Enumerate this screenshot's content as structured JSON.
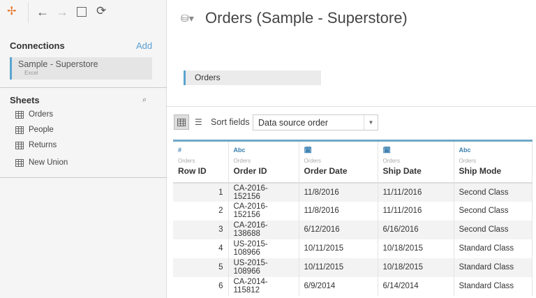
{
  "toolbar": {
    "logo": "tableau-logo",
    "back": "←",
    "forward": "→",
    "save": "save-icon",
    "refresh": "refresh-icon"
  },
  "sidebar": {
    "connections_label": "Connections",
    "add_label": "Add",
    "connection": {
      "name": "Sample - Superstore",
      "type": "Excel"
    },
    "sheets_label": "Sheets",
    "sheets": [
      {
        "label": "Orders"
      },
      {
        "label": "People"
      },
      {
        "label": "Returns"
      }
    ],
    "new_union": "New Union"
  },
  "main": {
    "title": "Orders (Sample - Superstore)",
    "table_box": "Orders",
    "sort_label": "Sort fields",
    "sort_value": "Data source order"
  },
  "grid": {
    "columns": [
      {
        "type": "#",
        "source": "Orders",
        "name": "Row ID"
      },
      {
        "type": "Abc",
        "source": "Orders",
        "name": "Order ID"
      },
      {
        "type": "date",
        "source": "Orders",
        "name": "Order Date"
      },
      {
        "type": "date",
        "source": "Orders",
        "name": "Ship Date"
      },
      {
        "type": "Abc",
        "source": "Orders",
        "name": "Ship Mode"
      }
    ],
    "rows": [
      [
        "1",
        "CA-2016-152156",
        "11/8/2016",
        "11/11/2016",
        "Second Class"
      ],
      [
        "2",
        "CA-2016-152156",
        "11/8/2016",
        "11/11/2016",
        "Second Class"
      ],
      [
        "3",
        "CA-2016-138688",
        "6/12/2016",
        "6/16/2016",
        "Second Class"
      ],
      [
        "4",
        "US-2015-108966",
        "10/11/2015",
        "10/18/2015",
        "Standard Class"
      ],
      [
        "5",
        "US-2015-108966",
        "10/11/2015",
        "10/18/2015",
        "Standard Class"
      ],
      [
        "6",
        "CA-2014-115812",
        "6/9/2014",
        "6/14/2014",
        "Standard Class"
      ]
    ]
  }
}
